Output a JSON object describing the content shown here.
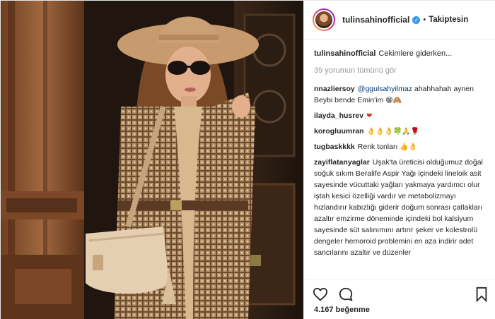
{
  "post": {
    "username": "tulinsahinofficial",
    "follow_status": "Takiptesin",
    "caption_user": "tulinsahinofficial",
    "caption_text": "Cekimlere giderken...",
    "view_all_comments": "39 yorumun tümünü gör",
    "likes": "4.167 beğenme"
  },
  "comments": [
    {
      "user": "nnazliersoy",
      "mention": "@ggulsahyilmaz",
      "text": " ahahhahah aynen Beybi bende Emin'im",
      "emoji": "😁🙈"
    },
    {
      "user": "ilayda_husrev",
      "mention": "",
      "text": "",
      "emoji": "❤"
    },
    {
      "user": "korogluumran",
      "mention": "",
      "text": "",
      "emoji": "👌👌👌🍀🙏🌹"
    },
    {
      "user": "tugbaskkkk",
      "mention": "",
      "text": "Renk tonları",
      "emoji": "👍👌"
    },
    {
      "user": "zayiflatanyaglar",
      "mention": "",
      "text": "Uşak'ta üreticisi olduğumuz doğal soğuk sıkım Beralife Aspir Yağı içindeki lineloik asit sayesinde vücuttaki yağları yakmaya yardımcı olur iştah kesici özelliği vardır ve metabolizmayı hızlandırır kabızlığı giderir doğum sonrası çatlakları azaltır emzirme döneminde içindeki bol kalsiyum sayesinde süt salınımını artırır şeker ve kolestrolü dengeler hemoroid problemini en aza indirir adet sancılarını azaltır ve düzenler",
      "emoji": ""
    }
  ],
  "icons": {
    "verified": "verified-badge-icon",
    "like": "heart-icon",
    "comment": "comment-bubble-icon",
    "save": "bookmark-icon"
  },
  "colors": {
    "verified_blue": "#3897f0",
    "mention_blue": "#003569",
    "muted": "#999999"
  }
}
